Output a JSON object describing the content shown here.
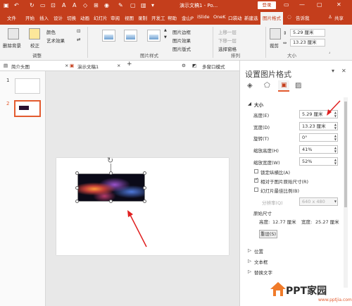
{
  "title_bar": {
    "window_title": "演示文稿1 - Po...",
    "login": "登录",
    "controls": [
      "▭",
      "—",
      "▢",
      "✕"
    ]
  },
  "tabs": [
    {
      "label": "文件"
    },
    {
      "label": "开始"
    },
    {
      "label": "插入"
    },
    {
      "label": "设计"
    },
    {
      "label": "切换"
    },
    {
      "label": "动画"
    },
    {
      "label": "幻灯片"
    },
    {
      "label": "审阅"
    },
    {
      "label": "视图"
    },
    {
      "label": "录制"
    },
    {
      "label": "开发工"
    },
    {
      "label": "帮助"
    },
    {
      "label": "金山P"
    },
    {
      "label": "iSlide"
    },
    {
      "label": "OneK"
    },
    {
      "label": "口袋动"
    },
    {
      "label": "新建选"
    },
    {
      "label": "图片格式"
    }
  ],
  "tabbar_extra": {
    "tellme": "告诉我",
    "share": "共享"
  },
  "ribbon": {
    "remove_bg": "删除背景",
    "corrections": "校正",
    "color": "颜色",
    "artistic": "艺术效果",
    "adjust_label": "调整",
    "styles_label": "图片样式",
    "border": "图片边框",
    "effects": "图片效果",
    "layout": "图片版式",
    "bring_forward": "上移一层",
    "send_backward": "下移一层",
    "selection_pane": "选择窗格",
    "arrange_label": "排列",
    "crop": "裁剪",
    "height_value": "5.29 厘米",
    "width_value": "13.23 厘米",
    "size_label": "大小"
  },
  "doc_tabs": [
    "简介头图",
    "演示文稿1",
    "多窗口模式"
  ],
  "slides": [
    {
      "number": "1"
    },
    {
      "number": "2"
    }
  ],
  "pane": {
    "title": "设置图片格式",
    "section_size": "大小",
    "fields": [
      {
        "label": "高度(E)",
        "value": "5.29 厘米"
      },
      {
        "label": "宽度(D)",
        "value": "13.23 厘米"
      },
      {
        "label": "旋转(T)",
        "value": "0°"
      },
      {
        "label": "缩放高度(H)",
        "value": "41%"
      },
      {
        "label": "缩放宽度(W)",
        "value": "52%"
      }
    ],
    "checkboxes": [
      {
        "label": "锁定纵横比(A)",
        "checked": false
      },
      {
        "label": "相对于图片原始尺寸(R)",
        "checked": true
      },
      {
        "label": "幻灯片最佳比例(B)",
        "checked": false
      }
    ],
    "resolution_label": "分辨率(Q)",
    "resolution_value": "640 x 480",
    "original_size": "原始尺寸",
    "orig_height_label": "高度:",
    "orig_height_value": "12.77 厘米",
    "orig_width_label": "宽度:",
    "orig_width_value": "25.27 厘米",
    "reset": "重设(S)",
    "section_position": "位置",
    "section_textbox": "文本框",
    "section_alttext": "替换文字"
  },
  "logo": {
    "text": "PPT家园",
    "url": "www.pptjia.com"
  },
  "colors": {
    "accent": "#c43e1c",
    "selection": "#e35b2f"
  }
}
